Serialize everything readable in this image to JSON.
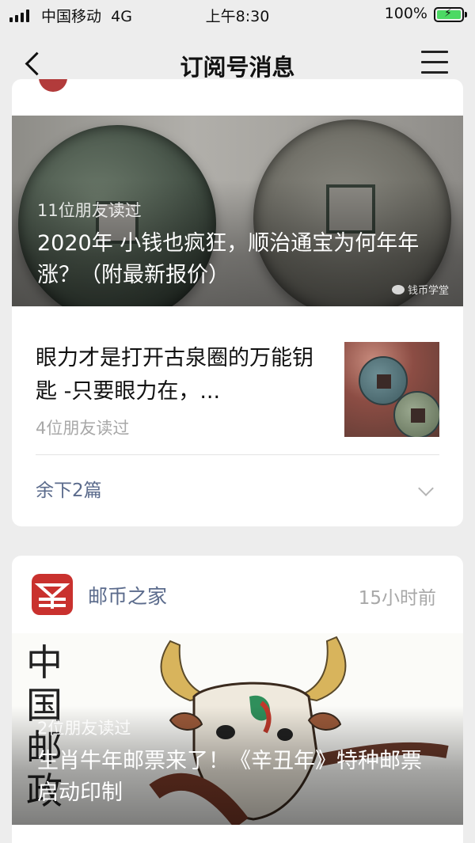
{
  "status_bar": {
    "carrier": "中国移动",
    "network": "4G",
    "time": "上午8:30",
    "battery": "100%"
  },
  "nav": {
    "title": "订阅号消息"
  },
  "card1": {
    "hero": {
      "readers": "11位朋友读过",
      "title": "2020年 小钱也疯狂，顺治通宝为何年年涨？（附最新报价）",
      "watermark": "钱币学堂"
    },
    "article": {
      "title": "眼力才是打开古泉圈的万能钥匙 -只要眼力在，...",
      "readers": "4位朋友读过"
    },
    "more_label": "余下2篇"
  },
  "card2": {
    "account_name": "邮币之家",
    "time": "15小时前",
    "hero": {
      "vertical_text": "中国邮政",
      "readers": "2位朋友读过",
      "title": "生肖牛年邮票来了！《辛丑年》特种邮票启动印制"
    }
  }
}
